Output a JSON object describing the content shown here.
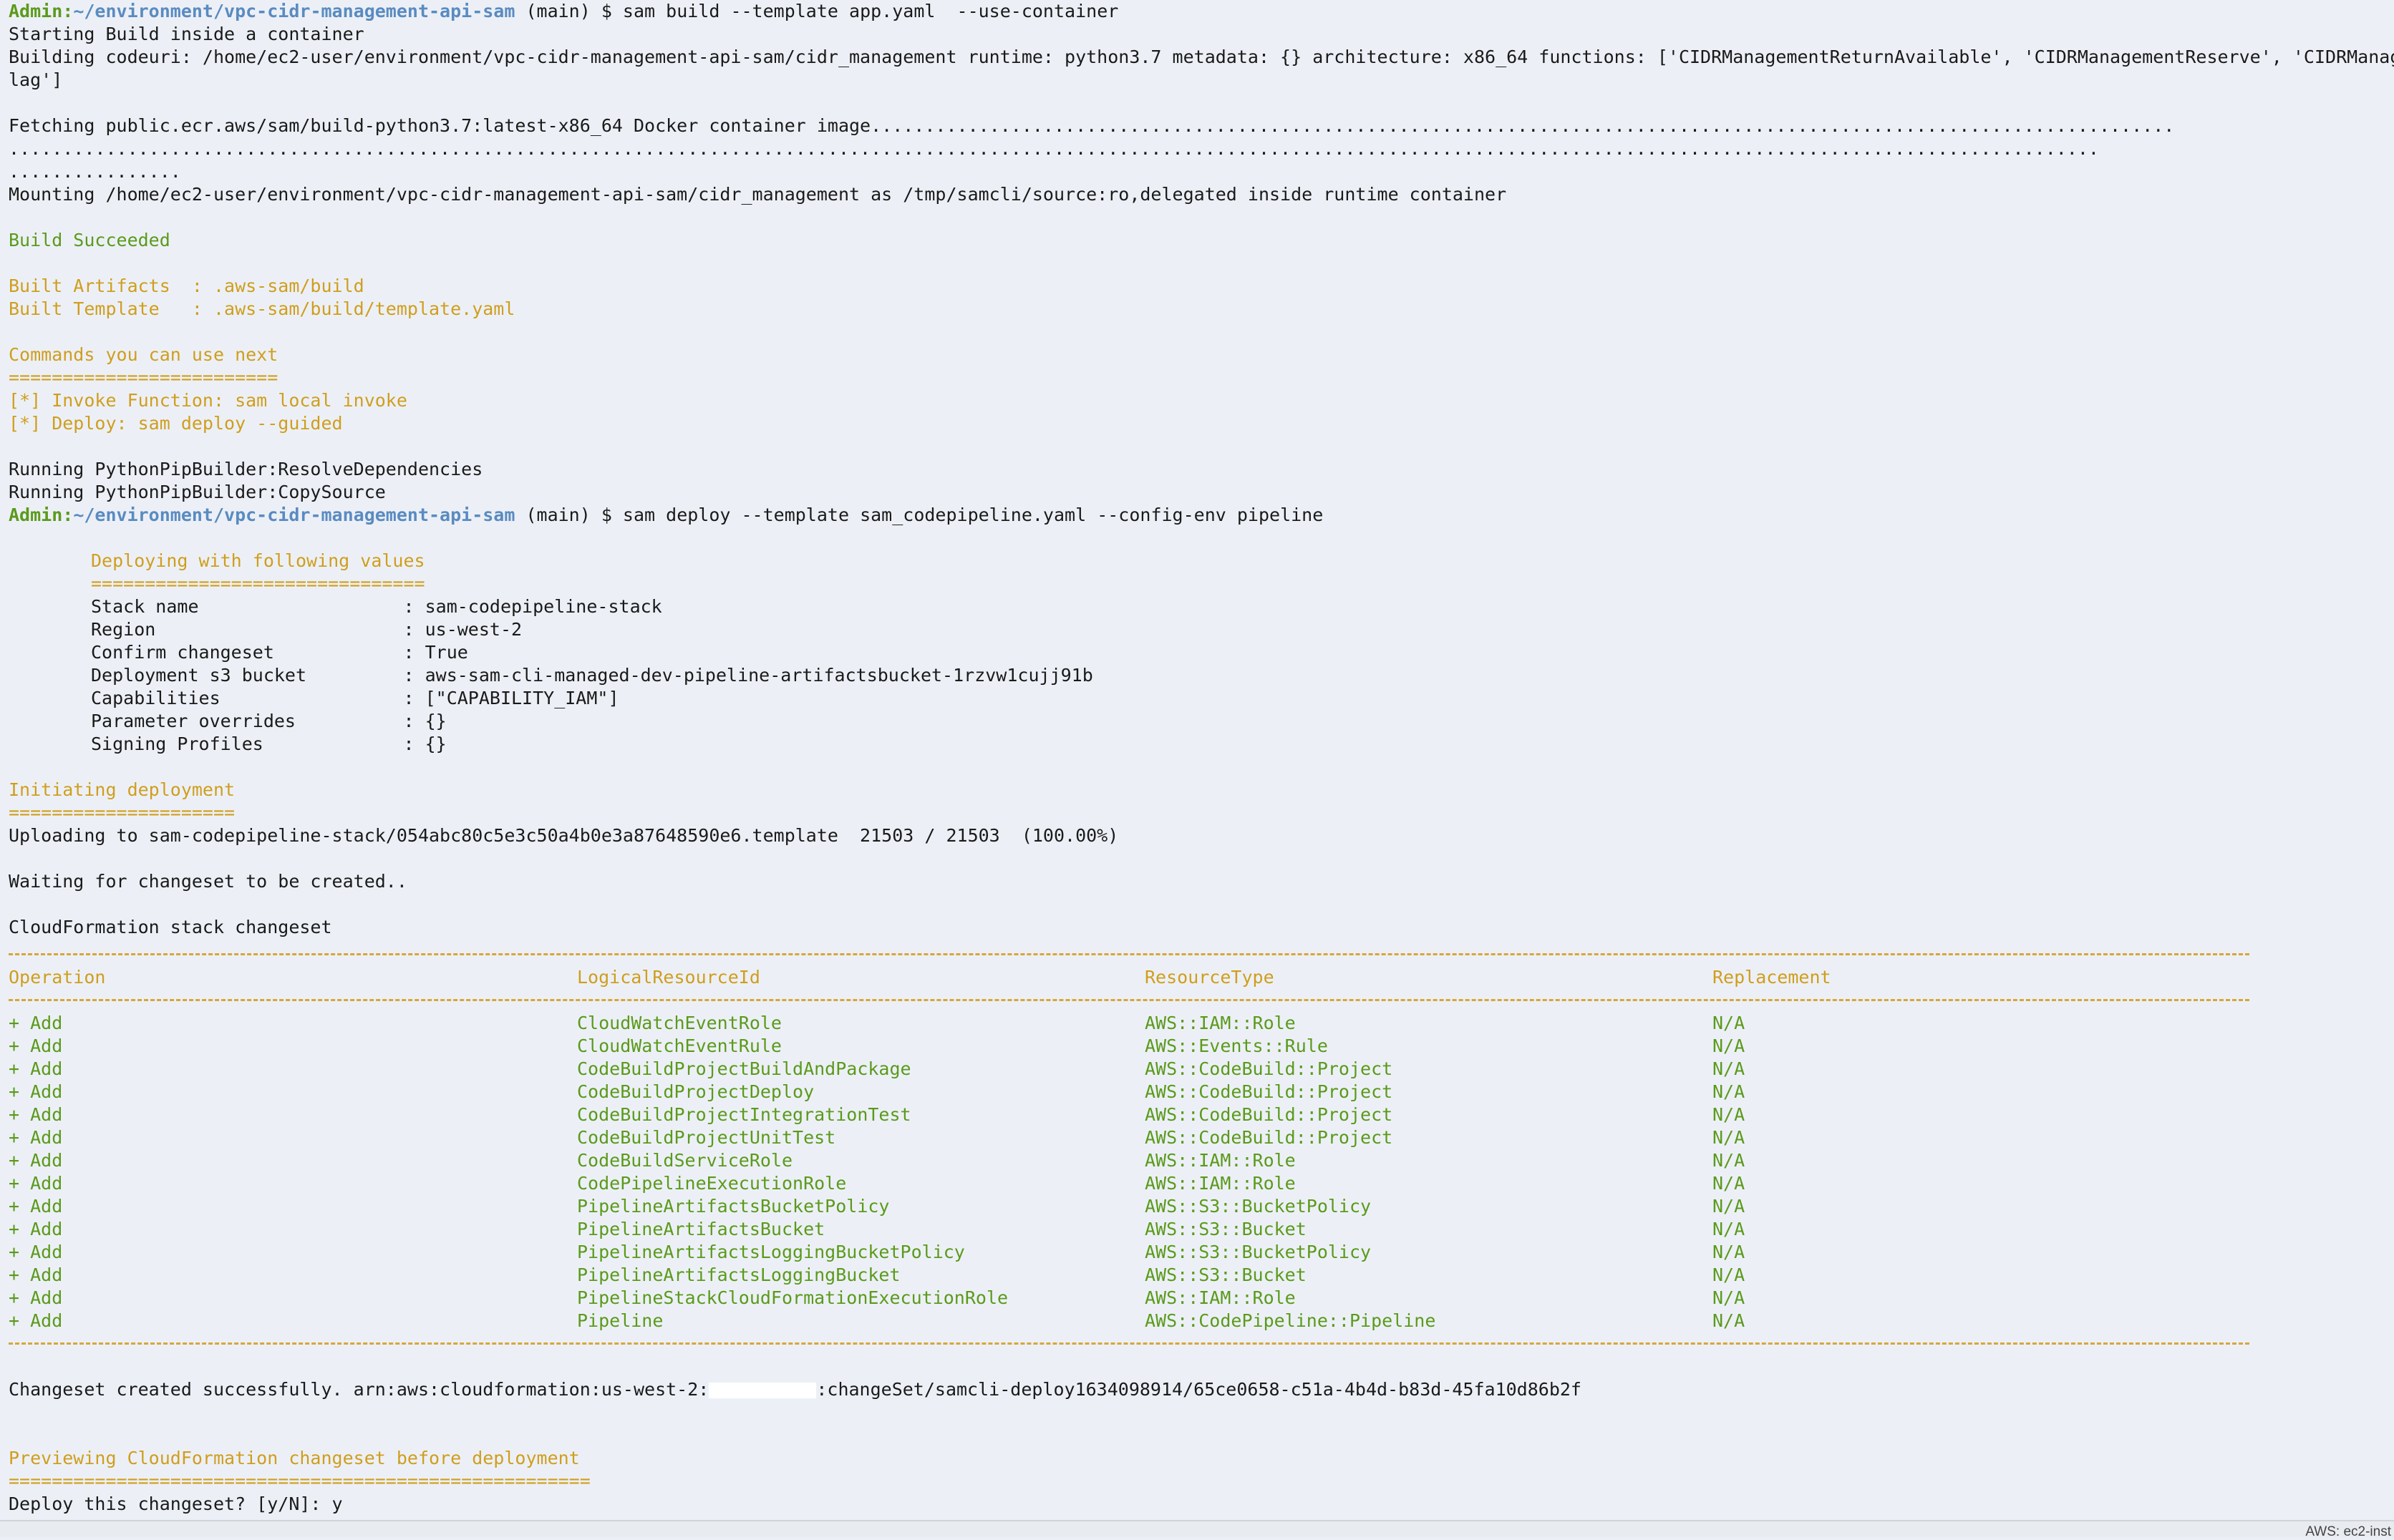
{
  "prompt1": {
    "user": "Admin:",
    "path": "~/environment/vpc-cidr-management-api-sam",
    "branch": " (main)",
    "command": " $ sam build --template app.yaml  --use-container"
  },
  "build": {
    "start": "Starting Build inside a container",
    "codeuri_1": "Building codeuri: /home/ec2-user/environment/vpc-cidr-management-api-sam/cidr_management runtime: python3.7 metadata: {} architecture: x86_64 functions: ['CIDRManagementReturnAvailable', 'CIDRManagementReserve', 'CIDRManagementF",
    "codeuri_2": "lag']",
    "fetch_1": "Fetching public.ecr.aws/sam/build-python3.7:latest-x86_64 Docker container image.........................................................................................................................",
    "fetch_2": "..................................................................................................................................................................................................",
    "fetch_3": "................",
    "mount": "Mounting /home/ec2-user/environment/vpc-cidr-management-api-sam/cidr_management as /tmp/samcli/source:ro,delegated inside runtime container",
    "succeeded": "Build Succeeded",
    "artifacts": "Built Artifacts  : .aws-sam/build",
    "template": "Built Template   : .aws-sam/build/template.yaml",
    "next_title": "Commands you can use next",
    "next_rule": "=========================",
    "next_1": "[*] Invoke Function: sam local invoke",
    "next_2": "[*] Deploy: sam deploy --guided",
    "resolve": "Running PythonPipBuilder:ResolveDependencies",
    "copy": "Running PythonPipBuilder:CopySource"
  },
  "prompt2": {
    "user": "Admin:",
    "path": "~/environment/vpc-cidr-management-api-sam",
    "branch": " (main)",
    "command": " $ sam deploy --template sam_codepipeline.yaml --config-env pipeline"
  },
  "deploy_values": {
    "title": "Deploying with following values",
    "rule": "===============================",
    "rows": [
      {
        "key": "Stack name                   : ",
        "val": "sam-codepipeline-stack"
      },
      {
        "key": "Region                       : ",
        "val": "us-west-2"
      },
      {
        "key": "Confirm changeset            : ",
        "val": "True"
      },
      {
        "key": "Deployment s3 bucket         : ",
        "val": "aws-sam-cli-managed-dev-pipeline-artifactsbucket-1rzvw1cujj91b"
      },
      {
        "key": "Capabilities                 : ",
        "val": "[\"CAPABILITY_IAM\"]"
      },
      {
        "key": "Parameter overrides          : ",
        "val": "{}"
      },
      {
        "key": "Signing Profiles             : ",
        "val": "{}"
      }
    ]
  },
  "init": {
    "title": "Initiating deployment",
    "rule": "=====================",
    "upload": "Uploading to sam-codepipeline-stack/054abc80c5e3c50a4b0e3a87648590e6.template  21503 / 21503  (100.00%)",
    "waiting": "Waiting for changeset to be created.."
  },
  "changeset": {
    "title": "CloudFormation stack changeset",
    "headers": [
      "Operation",
      "LogicalResourceId",
      "ResourceType",
      "Replacement"
    ],
    "rows": [
      [
        "+ Add",
        "CloudWatchEventRole",
        "AWS::IAM::Role",
        "N/A"
      ],
      [
        "+ Add",
        "CloudWatchEventRule",
        "AWS::Events::Rule",
        "N/A"
      ],
      [
        "+ Add",
        "CodeBuildProjectBuildAndPackage",
        "AWS::CodeBuild::Project",
        "N/A"
      ],
      [
        "+ Add",
        "CodeBuildProjectDeploy",
        "AWS::CodeBuild::Project",
        "N/A"
      ],
      [
        "+ Add",
        "CodeBuildProjectIntegrationTest",
        "AWS::CodeBuild::Project",
        "N/A"
      ],
      [
        "+ Add",
        "CodeBuildProjectUnitTest",
        "AWS::CodeBuild::Project",
        "N/A"
      ],
      [
        "+ Add",
        "CodeBuildServiceRole",
        "AWS::IAM::Role",
        "N/A"
      ],
      [
        "+ Add",
        "CodePipelineExecutionRole",
        "AWS::IAM::Role",
        "N/A"
      ],
      [
        "+ Add",
        "PipelineArtifactsBucketPolicy",
        "AWS::S3::BucketPolicy",
        "N/A"
      ],
      [
        "+ Add",
        "PipelineArtifactsBucket",
        "AWS::S3::Bucket",
        "N/A"
      ],
      [
        "+ Add",
        "PipelineArtifactsLoggingBucketPolicy",
        "AWS::S3::BucketPolicy",
        "N/A"
      ],
      [
        "+ Add",
        "PipelineArtifactsLoggingBucket",
        "AWS::S3::Bucket",
        "N/A"
      ],
      [
        "+ Add",
        "PipelineStackCloudFormationExecutionRole",
        "AWS::IAM::Role",
        "N/A"
      ],
      [
        "+ Add",
        "Pipeline",
        "AWS::CodePipeline::Pipeline",
        "N/A"
      ]
    ],
    "created_pre": "Changeset created successfully. arn:aws:cloudformation:us-west-2:",
    "created_post": ":changeSet/samcli-deploy1634098914/65ce0658-c51a-4b4d-b83d-45fa10d86b2f"
  },
  "preview": {
    "title": "Previewing CloudFormation changeset before deployment",
    "rule": "======================================================",
    "question": "Deploy this changeset? [y/N]: ",
    "answer": "y"
  },
  "statusbar": {
    "text": "AWS: ec2-inst"
  }
}
